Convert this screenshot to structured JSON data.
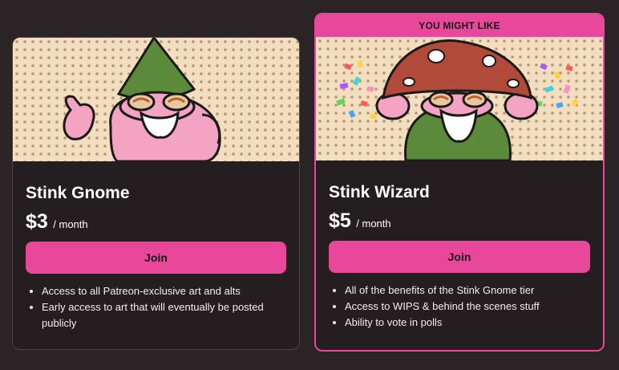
{
  "tiers": [
    {
      "name": "Stink Gnome",
      "price": "$3",
      "period": "/ month",
      "join_label": "Join",
      "benefits": [
        "Access to all Patreon-exclusive art and alts",
        "Early access to art that will eventually be posted publicly"
      ]
    },
    {
      "badge": "YOU MIGHT LIKE",
      "name": "Stink Wizard",
      "price": "$5",
      "period": "/ month",
      "join_label": "Join",
      "benefits": [
        "All of the benefits of the Stink Gnome tier",
        "Access to WIPS & behind the scenes stuff",
        "Ability to vote in polls"
      ]
    }
  ],
  "colors": {
    "accent": "#e8479a",
    "card_bg": "#241e21",
    "page_bg": "#2b2426"
  }
}
